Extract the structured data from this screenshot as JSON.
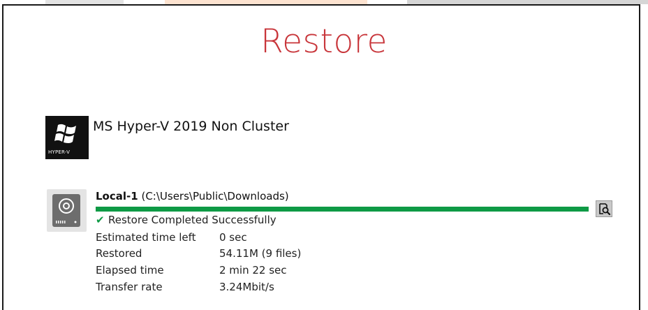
{
  "header": {
    "title": "Restore"
  },
  "source": {
    "app_icon_caption": "HYPER-V",
    "title": "MS Hyper-V 2019 Non Cluster"
  },
  "destination": {
    "label": "Local-1",
    "path": "(C:\\Users\\Public\\Downloads)",
    "progress": 1.0,
    "status": "Restore Completed Successfully",
    "details": [
      {
        "label": "Estimated time left",
        "value": "0 sec"
      },
      {
        "label": "Restored",
        "value": "54.11M (9 files)"
      },
      {
        "label": "Elapsed time",
        "value": "2 min 22 sec"
      },
      {
        "label": "Transfer rate",
        "value": "3.24Mbit/s"
      }
    ]
  },
  "icons": {
    "app": "windows-logo-icon",
    "destination": "hard-drive-icon",
    "preview": "magnifier-document-icon",
    "status": "check-icon"
  },
  "colors": {
    "title": "#c8353a",
    "progress": "#0e9a45",
    "check": "#0e9a45"
  }
}
